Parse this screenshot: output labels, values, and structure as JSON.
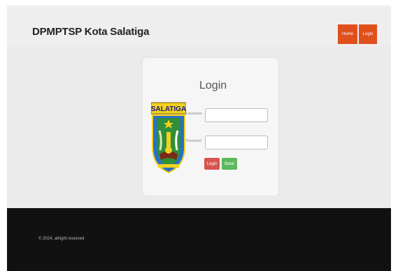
{
  "header": {
    "brand": "DPMPTSP Kota Salatiga"
  },
  "nav": {
    "home_label": "Home",
    "login_label": "Login"
  },
  "login_card": {
    "title": "Login",
    "logo_text": "SALATIGA",
    "username_label": "Username",
    "password_label": "Password",
    "submit_label": "Login",
    "cancel_label": "Batal"
  },
  "footer": {
    "text": "© 2024, allright reserved"
  },
  "colors": {
    "accent": "#e0501d",
    "login_button": "#d9534f",
    "cancel_button": "#5cb85c",
    "footer_bg": "#111111"
  }
}
